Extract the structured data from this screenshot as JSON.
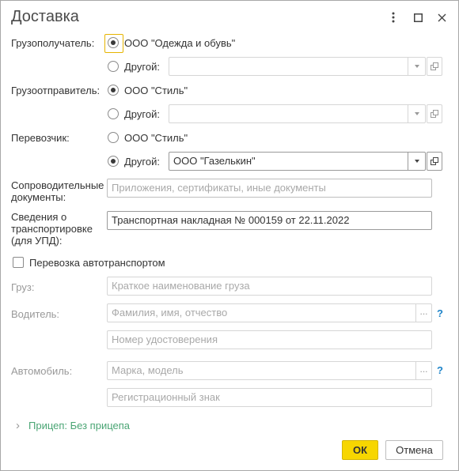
{
  "dialog": {
    "title": "Доставка"
  },
  "consignee": {
    "label": "Грузополучатель:",
    "option1": "ООО \"Одежда и обувь\"",
    "option2": "Другой:",
    "other_value": ""
  },
  "shipper": {
    "label": "Грузоотправитель:",
    "option1": "ООО \"Стиль\"",
    "option2": "Другой:",
    "other_value": ""
  },
  "carrier": {
    "label": "Перевозчик:",
    "option1": "ООО \"Стиль\"",
    "option2": "Другой:",
    "other_value": "ООО \"Газелькин\""
  },
  "documents": {
    "label_line1": "Сопроводительные",
    "label_line2": "документы:",
    "placeholder": "Приложения, сертификаты, иные документы"
  },
  "transport_info": {
    "label_line1": "Сведения о",
    "label_line2": "транспортировке",
    "label_line3": "(для УПД):",
    "value": "Транспортная накладная № 000159 от 22.11.2022"
  },
  "by_vehicle": {
    "label": "Перевозка автотранспортом"
  },
  "cargo": {
    "label": "Груз:",
    "placeholder": "Краткое наименование груза"
  },
  "driver": {
    "label": "Водитель:",
    "name_placeholder": "Фамилия, имя, отчество",
    "license_placeholder": "Номер удостоверения",
    "dots": "...",
    "help": "?"
  },
  "car": {
    "label": "Автомобиль:",
    "model_placeholder": "Марка, модель",
    "plate_placeholder": "Регистрационный знак",
    "dots": "...",
    "help": "?"
  },
  "trailer": {
    "chevron": "›",
    "label": "Прицеп: Без прицепа"
  },
  "buttons": {
    "ok": "ОК",
    "cancel": "Отмена"
  },
  "colors": {
    "accent": "#f7d600",
    "link": "#4aa574",
    "help": "#1e84c9"
  }
}
